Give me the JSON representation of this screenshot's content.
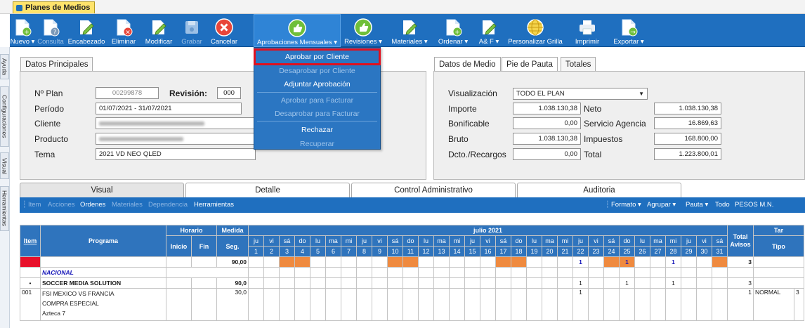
{
  "window": {
    "title": "Planes de Medios"
  },
  "toolbar": [
    {
      "label": "Nuevo ▾",
      "icon": "new-document-icon",
      "enabled": true
    },
    {
      "label": "Consulta",
      "icon": "query-document-icon",
      "enabled": false
    },
    {
      "label": "Encabezado",
      "icon": "edit-header-icon",
      "enabled": true
    },
    {
      "label": "Eliminar",
      "icon": "delete-document-icon",
      "enabled": true
    },
    {
      "label": "Modificar",
      "icon": "edit-document-icon",
      "enabled": true
    },
    {
      "label": "Grabar",
      "icon": "save-disk-icon",
      "enabled": false
    },
    {
      "label": "Cancelar",
      "icon": "cancel-circle-icon",
      "enabled": true
    },
    {
      "label": "Aprobaciones Mensuales ▾",
      "icon": "thumbs-up-icon",
      "enabled": true
    },
    {
      "label": "Revisiones ▾",
      "icon": "thumbs-up-icon",
      "enabled": true
    },
    {
      "label": "Materiales ▾",
      "icon": "edit-document-icon",
      "enabled": true
    },
    {
      "label": "Ordenar ▾",
      "icon": "sort-document-icon",
      "enabled": true
    },
    {
      "label": "A& F ▾",
      "icon": "edit-document-icon",
      "enabled": true
    },
    {
      "label": "Personalizar Grilla",
      "icon": "grid-globe-icon",
      "enabled": true
    },
    {
      "label": "Imprimir",
      "icon": "printer-icon",
      "enabled": true
    },
    {
      "label": "Exportar ▾",
      "icon": "export-document-icon",
      "enabled": true
    }
  ],
  "left_rail": [
    "Ayuda",
    "Configuraciones",
    "Visual",
    "Herramientas"
  ],
  "approvals_menu": [
    {
      "label": "Aprobar por Cliente",
      "enabled": true
    },
    {
      "label": "Desaprobar por Cliente",
      "enabled": false
    },
    {
      "label": "Adjuntar Aprobación",
      "enabled": true
    },
    {
      "label": "Aprobar para Facturar",
      "enabled": false
    },
    {
      "label": "Desaprobar para Facturar",
      "enabled": false
    },
    {
      "label": "Rechazar",
      "enabled": true
    },
    {
      "label": "Recuperar",
      "enabled": false
    }
  ],
  "main_data": {
    "tab": "Datos Principales",
    "plan_label": "Nº Plan",
    "plan_value": "00299878",
    "revision_label": "Revisión:",
    "revision_value": "000",
    "periodo_label": "Período",
    "periodo_value": "01/07/2021 - 31/07/2021",
    "cliente_label": "Cliente",
    "producto_label": "Producto",
    "tema_label": "Tema",
    "tema_value": "2021 VD NEO QLED"
  },
  "totals": {
    "tabs": [
      "Datos de Medio",
      "Pie de Pauta",
      "Totales"
    ],
    "visualizacion_label": "Visualización",
    "visualizacion_value": "TODO EL PLAN",
    "importe_label": "Importe",
    "importe_value": "1.038.130,38",
    "bonificable_label": "Bonificable",
    "bonificable_value": "0,00",
    "bruto_label": "Bruto",
    "bruto_value": "1.038.130,38",
    "dcto_label": "Dcto./Recargos",
    "dcto_value": "0,00",
    "neto_label": "Neto",
    "neto_value": "1.038.130,38",
    "servicio_label": "Servicio Agencia",
    "servicio_value": "16.869,63",
    "impuestos_label": "Impuestos",
    "impuestos_value": "168.800,00",
    "total_label": "Total",
    "total_value": "1.223.800,01"
  },
  "section_tabs": [
    "Visual",
    "Detalle",
    "Control Administrativo",
    "Auditoria"
  ],
  "subbar": {
    "left": [
      {
        "label": "Item",
        "enabled": false
      },
      {
        "label": "Acciones",
        "enabled": false
      },
      {
        "label": "Ordenes",
        "enabled": true
      },
      {
        "label": "Materiales",
        "enabled": false
      },
      {
        "label": "Dependencia",
        "enabled": false
      },
      {
        "label": "Herramientas",
        "enabled": true
      }
    ],
    "right": [
      "Formato ▾",
      "Agrupar ▾",
      "Pauta ▾",
      "Todo",
      "PESOS M.N."
    ]
  },
  "grid": {
    "item_header": "Item",
    "programa_header": "Programa",
    "horario_header": "Horario",
    "inicio_header": "Inicio",
    "fin_header": "Fin",
    "medida_header": "Medida",
    "seg_header": "Seg.",
    "month_header": "julio 2021",
    "total_header": "Total Avisos",
    "tar_header": "Tar",
    "tipo_header": "Tipo",
    "weekdays": [
      "ju",
      "vi",
      "sá",
      "do",
      "lu",
      "ma",
      "mi",
      "ju",
      "vi",
      "sá",
      "do",
      "lu",
      "ma",
      "mi",
      "ju",
      "vi",
      "sá",
      "do",
      "lu",
      "ma",
      "mi",
      "ju",
      "vi",
      "sá",
      "do",
      "lu",
      "ma",
      "mi",
      "ju",
      "vi",
      "sá"
    ],
    "days": [
      "1",
      "2",
      "3",
      "4",
      "5",
      "6",
      "7",
      "8",
      "9",
      "10",
      "11",
      "12",
      "13",
      "14",
      "15",
      "16",
      "17",
      "18",
      "19",
      "20",
      "21",
      "22",
      "23",
      "24",
      "25",
      "26",
      "27",
      "28",
      "29",
      "30",
      "31"
    ],
    "weekend_days": [
      3,
      4,
      10,
      11,
      17,
      18,
      24,
      25,
      31
    ],
    "summary_row": {
      "seg": "90,00",
      "marks": {
        "22": "1",
        "25": "1",
        "28": "1"
      },
      "total": "3"
    },
    "group_row": {
      "label": "NACIONAL"
    },
    "vendor_row": {
      "item": "•",
      "programa": "SOCCER MEDIA SOLUTION",
      "seg": "90,0",
      "marks": {
        "22": "1",
        "25": "1",
        "28": "1"
      },
      "total": "3"
    },
    "detail_row": {
      "item": "001",
      "programa_lines": [
        "FSI MEXICO VS FRANCIA",
        "COMPRA ESPECIAL",
        "Azteca 7"
      ],
      "seg": "30,0",
      "marks": {
        "22": "1"
      },
      "total": "1",
      "tipo": "NORMAL",
      "tar": "3"
    }
  },
  "colors": {
    "toolbar_blue": "#1f6fbf",
    "highlight_red": "#e0101e",
    "weekend_orange": "#ef8a3f"
  }
}
